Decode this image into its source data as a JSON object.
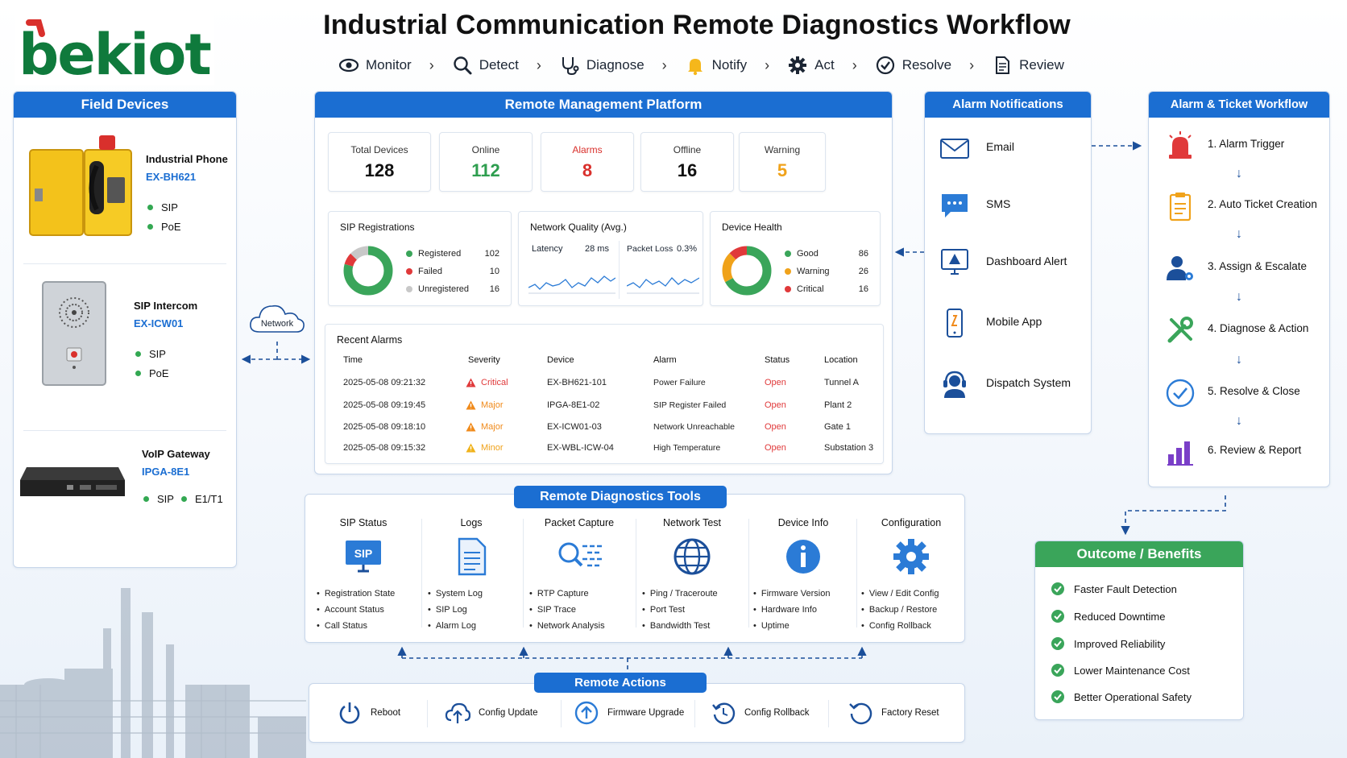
{
  "logo_text": "bekiot",
  "title": "Industrial Communication Remote Diagnostics Workflow",
  "steps": [
    {
      "label": "Monitor",
      "icon": "eye-icon"
    },
    {
      "label": "Detect",
      "icon": "magnifier-icon"
    },
    {
      "label": "Diagnose",
      "icon": "stethoscope-icon"
    },
    {
      "label": "Notify",
      "icon": "bell-icon"
    },
    {
      "label": "Act",
      "icon": "gear-icon"
    },
    {
      "label": "Resolve",
      "icon": "check-circle-icon"
    },
    {
      "label": "Review",
      "icon": "document-icon"
    }
  ],
  "field": {
    "title": "Field Devices",
    "devices": [
      {
        "name": "Industrial Phone",
        "model": "EX-BH621",
        "tags": [
          "SIP",
          "PoE"
        ]
      },
      {
        "name": "SIP Intercom",
        "model": "EX-ICW01",
        "tags": [
          "SIP",
          "PoE"
        ]
      },
      {
        "name": "VoIP Gateway",
        "model": "IPGA-8E1",
        "tags": [
          "SIP",
          "E1/T1"
        ]
      }
    ]
  },
  "network_label": "Network",
  "platform": {
    "title": "Remote Management Platform",
    "kpis": [
      {
        "label": "Total Devices",
        "value": "128",
        "color": "#111111"
      },
      {
        "label": "Online",
        "value": "112",
        "color": "#2e9e4f"
      },
      {
        "label": "Alarms",
        "value": "8",
        "color": "#d9302c"
      },
      {
        "label": "Offline",
        "value": "16",
        "color": "#111111"
      },
      {
        "label": "Warning",
        "value": "5",
        "color": "#f0a21a"
      }
    ],
    "sip": {
      "title": "SIP Registrations",
      "items": [
        {
          "label": "Registered",
          "value": 102,
          "color": "#3aa55a"
        },
        {
          "label": "Failed",
          "value": 10,
          "color": "#e0393a"
        },
        {
          "label": "Unregistered",
          "value": 16,
          "color": "#c8c8c8"
        }
      ]
    },
    "network": {
      "title": "Network Quality (Avg.)",
      "latency_label": "Latency",
      "latency_value": "28 ms",
      "loss_label": "Packet Loss",
      "loss_value": "0.3%"
    },
    "health": {
      "title": "Device Health",
      "items": [
        {
          "label": "Good",
          "value": 86,
          "color": "#3aa55a"
        },
        {
          "label": "Warning",
          "value": 26,
          "color": "#f0a21a"
        },
        {
          "label": "Critical",
          "value": 16,
          "color": "#e0393a"
        }
      ]
    },
    "alarms": {
      "title": "Recent Alarms",
      "headers": [
        "Time",
        "Severity",
        "Device",
        "Alarm",
        "Status",
        "Location"
      ],
      "rows": [
        {
          "time": "2025-05-08 09:21:32",
          "severity": "Critical",
          "sev_color": "#e0393a",
          "device": "EX-BH621-101",
          "alarm": "Power Failure",
          "status": "Open",
          "location": "Tunnel A"
        },
        {
          "time": "2025-05-08 09:19:45",
          "severity": "Major",
          "sev_color": "#f08a1a",
          "device": "IPGA-8E1-02",
          "alarm": "SIP Register Failed",
          "status": "Open",
          "location": "Plant 2"
        },
        {
          "time": "2025-05-08 09:18:10",
          "severity": "Major",
          "sev_color": "#f08a1a",
          "device": "EX-ICW01-03",
          "alarm": "Network Unreachable",
          "status": "Open",
          "location": "Gate 1"
        },
        {
          "time": "2025-05-08 09:15:32",
          "severity": "Minor",
          "sev_color": "#f0b21a",
          "device": "EX-WBL-ICW-04",
          "alarm": "High Temperature",
          "status": "Open",
          "location": "Substation 3"
        }
      ]
    }
  },
  "notifications": {
    "title": "Alarm Notifications",
    "items": [
      {
        "label": "Email",
        "icon": "envelope-icon"
      },
      {
        "label": "SMS",
        "icon": "chat-bubble-icon"
      },
      {
        "label": "Dashboard Alert",
        "icon": "monitor-alert-icon"
      },
      {
        "label": "Mobile App",
        "icon": "smartphone-icon"
      },
      {
        "label": "Dispatch System",
        "icon": "headset-icon"
      }
    ]
  },
  "workflow": {
    "title": "Alarm & Ticket Workflow",
    "items": [
      {
        "label": "1. Alarm Trigger",
        "icon": "siren-icon"
      },
      {
        "label": "2. Auto Ticket Creation",
        "icon": "clipboard-icon"
      },
      {
        "label": "3. Assign & Escalate",
        "icon": "user-gear-icon"
      },
      {
        "label": "4. Diagnose & Action",
        "icon": "tools-icon"
      },
      {
        "label": "5. Resolve & Close",
        "icon": "check-circle-icon"
      },
      {
        "label": "6. Review & Report",
        "icon": "bar-chart-icon"
      }
    ]
  },
  "tools": {
    "title": "Remote Diagnostics Tools",
    "items": [
      {
        "title": "SIP Status",
        "icon": "sip-monitor-icon",
        "bullets": [
          "Registration State",
          "Account Status",
          "Call Status"
        ]
      },
      {
        "title": "Logs",
        "icon": "log-file-icon",
        "bullets": [
          "System Log",
          "SIP Log",
          "Alarm Log"
        ]
      },
      {
        "title": "Packet Capture",
        "icon": "packet-search-icon",
        "bullets": [
          "RTP Capture",
          "SIP Trace",
          "Network Analysis"
        ]
      },
      {
        "title": "Network Test",
        "icon": "globe-icon",
        "bullets": [
          "Ping / Traceroute",
          "Port Test",
          "Bandwidth Test"
        ]
      },
      {
        "title": "Device Info",
        "icon": "info-icon",
        "bullets": [
          "Firmware Version",
          "Hardware Info",
          "Uptime"
        ]
      },
      {
        "title": "Configuration",
        "icon": "gear-icon",
        "bullets": [
          "View / Edit Config",
          "Backup / Restore",
          "Config Rollback"
        ]
      }
    ]
  },
  "actions": {
    "title": "Remote Actions",
    "items": [
      {
        "label": "Reboot",
        "icon": "power-icon"
      },
      {
        "label": "Config Update",
        "icon": "cloud-upload-icon"
      },
      {
        "label": "Firmware Upgrade",
        "icon": "upload-circle-icon"
      },
      {
        "label": "Config Rollback",
        "icon": "rollback-icon"
      },
      {
        "label": "Factory Reset",
        "icon": "reset-icon"
      }
    ]
  },
  "outcome": {
    "title": "Outcome / Benefits",
    "items": [
      "Faster Fault Detection",
      "Reduced Downtime",
      "Improved Reliability",
      "Lower Maintenance Cost",
      "Better Operational Safety"
    ]
  },
  "colors": {
    "brand": "#1b6ed2",
    "logo_green": "#0f7a3c",
    "logo_red": "#d9302c",
    "outcome_green": "#3aa55a"
  }
}
